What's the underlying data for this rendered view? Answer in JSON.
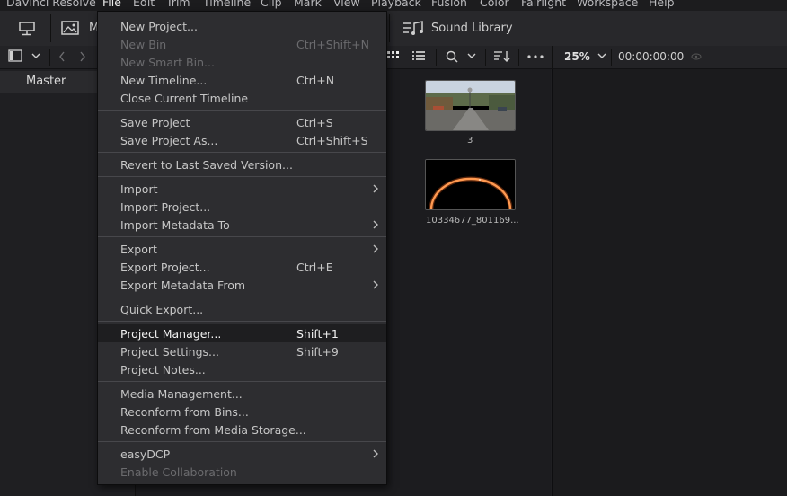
{
  "menubar": {
    "items": [
      "DaVinci Resolve",
      "File",
      "Edit",
      "Trim",
      "Timeline",
      "Clip",
      "Mark",
      "View",
      "Playback",
      "Fusion",
      "Color",
      "Fairlight",
      "Workspace",
      "Help"
    ]
  },
  "toolbar": {
    "media_label_partial": "M",
    "sound_library_label": "Sound Library"
  },
  "subbar": {
    "zoom": "25%",
    "timecode": "00:00:00:00"
  },
  "bins": {
    "master_label": "Master"
  },
  "media_pool": {
    "clips": [
      {
        "label": "3"
      },
      {
        "label": "10334677_801169..."
      }
    ]
  },
  "file_menu": {
    "groups": [
      [
        {
          "label": "New Project...",
          "shortcut": "",
          "disabled": false,
          "submenu": false
        },
        {
          "label": "New Bin",
          "shortcut": "Ctrl+Shift+N",
          "disabled": true,
          "submenu": false
        },
        {
          "label": "New Smart Bin...",
          "shortcut": "",
          "disabled": true,
          "submenu": false
        },
        {
          "label": "New Timeline...",
          "shortcut": "Ctrl+N",
          "disabled": false,
          "submenu": false
        },
        {
          "label": "Close Current Timeline",
          "shortcut": "",
          "disabled": false,
          "submenu": false
        }
      ],
      [
        {
          "label": "Save Project",
          "shortcut": "Ctrl+S",
          "disabled": false,
          "submenu": false
        },
        {
          "label": "Save Project As...",
          "shortcut": "Ctrl+Shift+S",
          "disabled": false,
          "submenu": false
        }
      ],
      [
        {
          "label": "Revert to Last Saved Version...",
          "shortcut": "",
          "disabled": false,
          "submenu": false
        }
      ],
      [
        {
          "label": "Import",
          "shortcut": "",
          "disabled": false,
          "submenu": true
        },
        {
          "label": "Import Project...",
          "shortcut": "",
          "disabled": false,
          "submenu": false
        },
        {
          "label": "Import Metadata To",
          "shortcut": "",
          "disabled": false,
          "submenu": true
        }
      ],
      [
        {
          "label": "Export",
          "shortcut": "",
          "disabled": false,
          "submenu": true
        },
        {
          "label": "Export Project...",
          "shortcut": "Ctrl+E",
          "disabled": false,
          "submenu": false
        },
        {
          "label": "Export Metadata From",
          "shortcut": "",
          "disabled": false,
          "submenu": true
        }
      ],
      [
        {
          "label": "Quick Export...",
          "shortcut": "",
          "disabled": false,
          "submenu": false
        }
      ],
      [
        {
          "label": "Project Manager...",
          "shortcut": "Shift+1",
          "disabled": false,
          "submenu": false,
          "highlighted": true
        },
        {
          "label": "Project Settings...",
          "shortcut": "Shift+9",
          "disabled": false,
          "submenu": false
        },
        {
          "label": "Project Notes...",
          "shortcut": "",
          "disabled": false,
          "submenu": false
        }
      ],
      [
        {
          "label": "Media Management...",
          "shortcut": "",
          "disabled": false,
          "submenu": false
        },
        {
          "label": "Reconform from Bins...",
          "shortcut": "",
          "disabled": false,
          "submenu": false
        },
        {
          "label": "Reconform from Media Storage...",
          "shortcut": "",
          "disabled": false,
          "submenu": false
        }
      ],
      [
        {
          "label": "easyDCP",
          "shortcut": "",
          "disabled": false,
          "submenu": true
        },
        {
          "label": "Enable Collaboration",
          "shortcut": "",
          "disabled": true,
          "submenu": false
        }
      ]
    ]
  }
}
